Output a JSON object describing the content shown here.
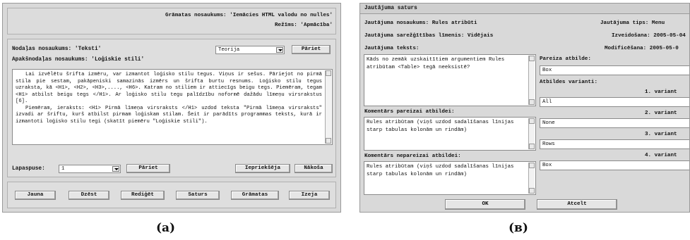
{
  "panel_a": {
    "header": {
      "book_title_line": "Grāmatas nosaukums: 'Iemācies HTML valodu no nulles'",
      "mode_line": "Režīms: 'Apmācība'"
    },
    "section_label": "Nodaļas nosaukums: 'Teksti'",
    "subsection_label": "Apakšnodaļas nosaukums: 'Loģiskie stili'",
    "type_select_value": "Teorija",
    "go_button": "Pāriet",
    "text_paragraphs": [
      "Lai izvēlētu šrifta izmēru, var izmantot loģisko stilu tegus. Viņus ir sešus. Pāriejot no pirmā stila pie sestam, pakāpeniski samazinās izmērs un šrifta burtu resnums. Loģisko stilu tegus uzraksta, kā <H1>, <H2>, <H3>,...., <H6>. Katram no stiliem ir attiecīgs beigu tegs. Piemēram, tegam <H1> atbilst beigu tegs </H1>. Ar loģisko stilu tegu palīdzību noformē dažādu līmeņu virsrakstus [6].",
      "Piemēram, ieraksts: <H1> Pirmā līmeņa virsraksts </H1> uzdod teksta \"Pirmā līmeņa virsraksts\" izvadi ar šriftu, kurš atbilst pirmam loģiskam stilam. Šeit ir parādīts programmas teksts, kurā ir izmantoti loģisko stilu tegi (skatīt piemēru \"Loģiskie stili\")."
    ],
    "page_label": "Lapaspuse:",
    "page_value": "1",
    "page_go_button": "Pāriet",
    "prev_button": "Iepriekšēja",
    "next_button": "Nākoša",
    "footer_buttons": [
      "Jauna",
      "Dzēst",
      "Rediģēt",
      "Saturs",
      "Grāmatas",
      "Izeja"
    ]
  },
  "panel_b": {
    "title": "Jautājuma saturs",
    "question_name": "Jautājuma nosaukums: Rules atribūti",
    "question_type": "Jautājuma tips: Menu",
    "difficulty": "Jautājuma sarežģītības līmenis: Vidējais",
    "created": "Izveidošana: 2005-05-04",
    "modified": "Modificēšana: 2005-05-0",
    "question_text_label": "Jautājuma teksts:",
    "question_text": "Kāds no zemāk uzskaitītiem argumentiem Rules atribūtam <Table> tegā neeksistē?",
    "correct_answer_label": "Pareiza atbilde:",
    "correct_answer": "Box",
    "variants_label": "Atbildes varianti:",
    "comment_correct_label": "Komentārs pareizai atbildei:",
    "comment_correct": "Rules atribūtam (viņš uzdod sadalīšanas līnijas starp tabulas kolonām un rindām)",
    "comment_wrong_label": "Komentārs nepareizai atbildei:",
    "comment_wrong": "Rules atribūtam (viņš uzdod sadalīšanas līnijas starp tabulas kolonām un rindām)",
    "variants": [
      {
        "label": "1. variant",
        "value": "All"
      },
      {
        "label": "2. variant",
        "value": "None"
      },
      {
        "label": "3. variant",
        "value": "Rows"
      },
      {
        "label": "4. variant",
        "value": "Box"
      }
    ],
    "ok_button": "OK",
    "cancel_button": "Atcelt"
  },
  "captions": {
    "a": "(a)",
    "b": "(в)"
  }
}
